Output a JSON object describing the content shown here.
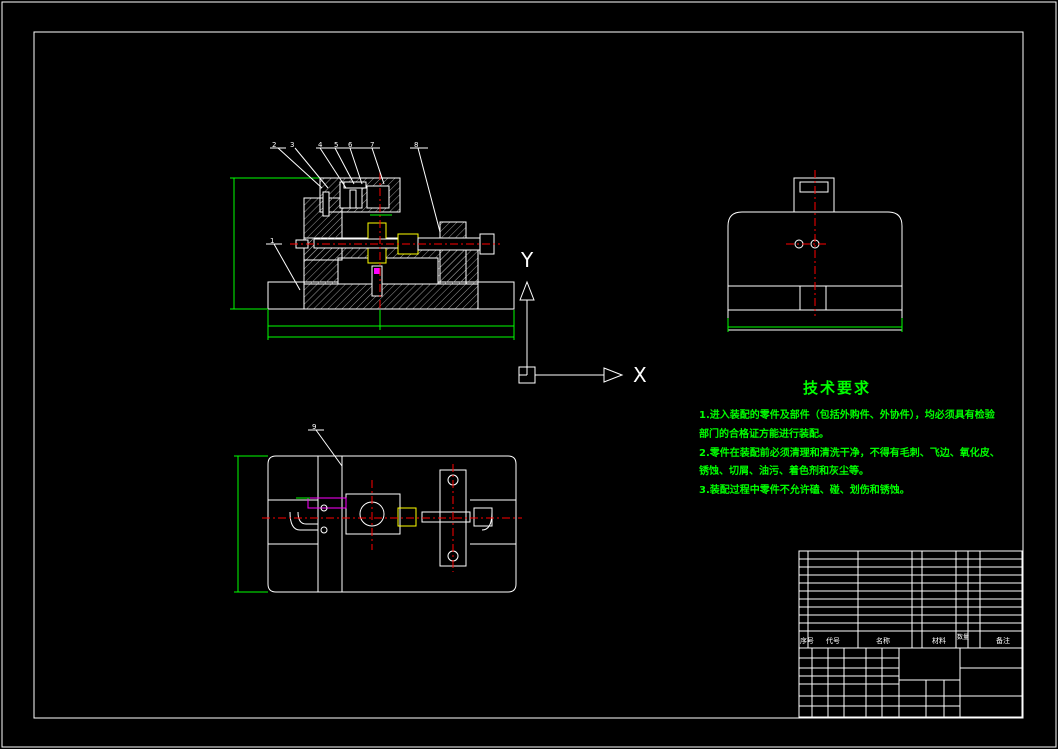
{
  "technical_requirements": {
    "title": "技术要求",
    "lines": [
      "1.进入装配的零件及部件（包括外购件、外协件），均必须具有检验",
      "部门的合格证方能进行装配。",
      "2.零件在装配前必须清理和清洗干净，不得有毛刺、飞边、氧化皮、",
      "锈蚀、切屑、油污、着色剂和灰尘等。",
      "3.装配过程中零件不允许磕、碰、划伤和锈蚀。"
    ]
  },
  "axes": {
    "y_label": "Y",
    "x_label": "X"
  },
  "balloons": [
    "2",
    "3",
    "4",
    "5",
    "6",
    "7",
    "8",
    "1",
    "9"
  ],
  "bom_header": {
    "seq": "序号",
    "code": "代号",
    "name": "名称",
    "material": "材料",
    "qty": "数量",
    "remark": "备注"
  },
  "colors": {
    "frame": "#ffffff",
    "dimension": "#00ff00",
    "centerline": "#ff0000",
    "hatch": "#808080",
    "balloon": "#ffffff",
    "text": "#00ff00",
    "accent": "#ff00ff"
  }
}
